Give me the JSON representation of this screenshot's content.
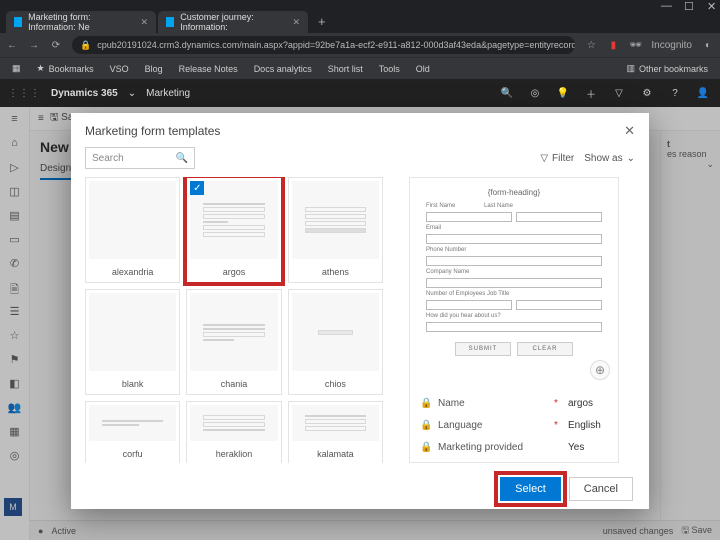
{
  "browser": {
    "tabs": [
      {
        "label": "Marketing form: Information: Ne"
      },
      {
        "label": "Customer journey: Information:"
      }
    ],
    "url": "cpub20191024.crm3.dynamics.com/main.aspx?appid=92be7a1a-ecf2-e911-a812-000d3af43eda&pagetype=entityrecord&etn=msdy…",
    "incognito": "Incognito",
    "bookmarks": [
      "Bookmarks",
      "VSO",
      "Blog",
      "Release Notes",
      "Docs analytics",
      "Short list",
      "Tools",
      "Old"
    ],
    "other_bookmarks": "Other bookmarks"
  },
  "appbar": {
    "product": "Dynamics 365",
    "area": "Marketing"
  },
  "page": {
    "save": "Save",
    "title_prefix": "New I",
    "design_tab": "Design",
    "footer_status": "Active",
    "footer_right": "unsaved changes",
    "footer_save": "Save",
    "side_hint": "es reason",
    "side_label": "t"
  },
  "modal": {
    "title": "Marketing form templates",
    "search_placeholder": "Search",
    "filter": "Filter",
    "show_as": "Show as",
    "templates": [
      "alexandria",
      "argos",
      "athens",
      "blank",
      "chania",
      "chios",
      "corfu",
      "heraklion",
      "kalamata"
    ],
    "selected_index": 1,
    "preview": {
      "heading": "{form-heading}",
      "fields_left": [
        "First Name",
        "Last Name"
      ],
      "fields": [
        "Email",
        "Phone Number",
        "Phone",
        "Company Name",
        "Company",
        "Number of Employees  Job Title",
        "Employee",
        "How did you hear about us?"
      ],
      "submit": "SUBMIT",
      "clear": "CLEAR"
    },
    "props": {
      "name_label": "Name",
      "name_value": "argos",
      "lang_label": "Language",
      "lang_value": "English",
      "mkt_label": "Marketing provided",
      "mkt_value": "Yes"
    },
    "select": "Select",
    "cancel": "Cancel"
  }
}
